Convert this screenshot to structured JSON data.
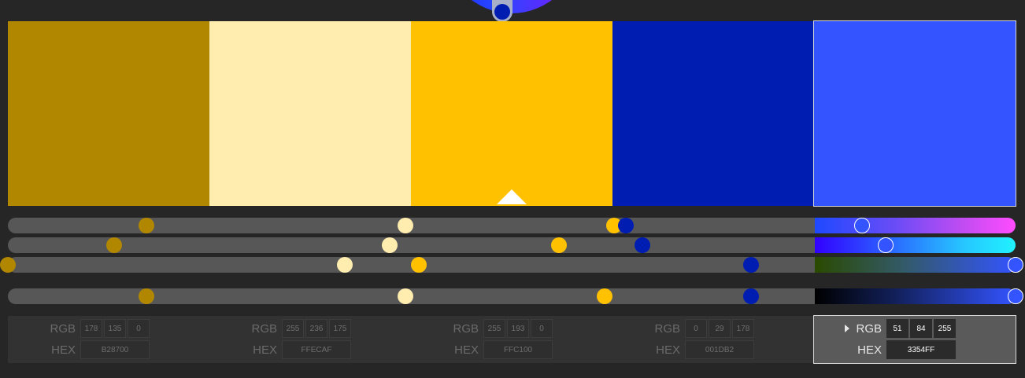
{
  "colors": [
    {
      "hex": "#B28700",
      "r": "178",
      "g": "135",
      "b": "0",
      "hex_label": "B28700"
    },
    {
      "hex": "#FFECAF",
      "r": "255",
      "g": "236",
      "b": "175",
      "hex_label": "FFECAF"
    },
    {
      "hex": "#FFC100",
      "r": "255",
      "g": "193",
      "b": "0",
      "hex_label": "FFC100"
    },
    {
      "hex": "#001DB2",
      "r": "0",
      "g": "29",
      "b": "178",
      "hex_label": "001DB2"
    },
    {
      "hex": "#3354FF",
      "r": "51",
      "g": "84",
      "b": "255",
      "hex_label": "3354FF"
    }
  ],
  "active_index": 4,
  "base_index": 2,
  "labels": {
    "rgb": "RGB",
    "hex": "HEX"
  },
  "sliders": [
    {
      "name": "hue",
      "positions": [
        0.1375,
        0.3945,
        0.6016,
        0.6133,
        0.8477
      ]
    },
    {
      "name": "saturation",
      "positions": [
        0.1055,
        0.3789,
        0.5469,
        0.6297,
        0.8711
      ]
    },
    {
      "name": "value",
      "positions": [
        0.0,
        0.3344,
        0.4078,
        0.7375,
        1.0
      ]
    },
    {
      "name": "brightness",
      "positions": [
        0.1375,
        0.3945,
        0.5922,
        0.7375,
        1.0
      ]
    }
  ],
  "gradients": {
    "hue": "linear-gradient(90deg,#1f49ff,#6a4cf6 40%,#c44cf2 75%,#ff4cff)",
    "saturation": "linear-gradient(90deg,#3200ff,#2a6cff 40%,#26c8ff 75%,#20f2ff)",
    "value": "linear-gradient(90deg,#2a4a00,#335a6a 45%,#3354ff)",
    "brightness": "linear-gradient(90deg,#000000,#12205a 40%,#3354ff)"
  }
}
